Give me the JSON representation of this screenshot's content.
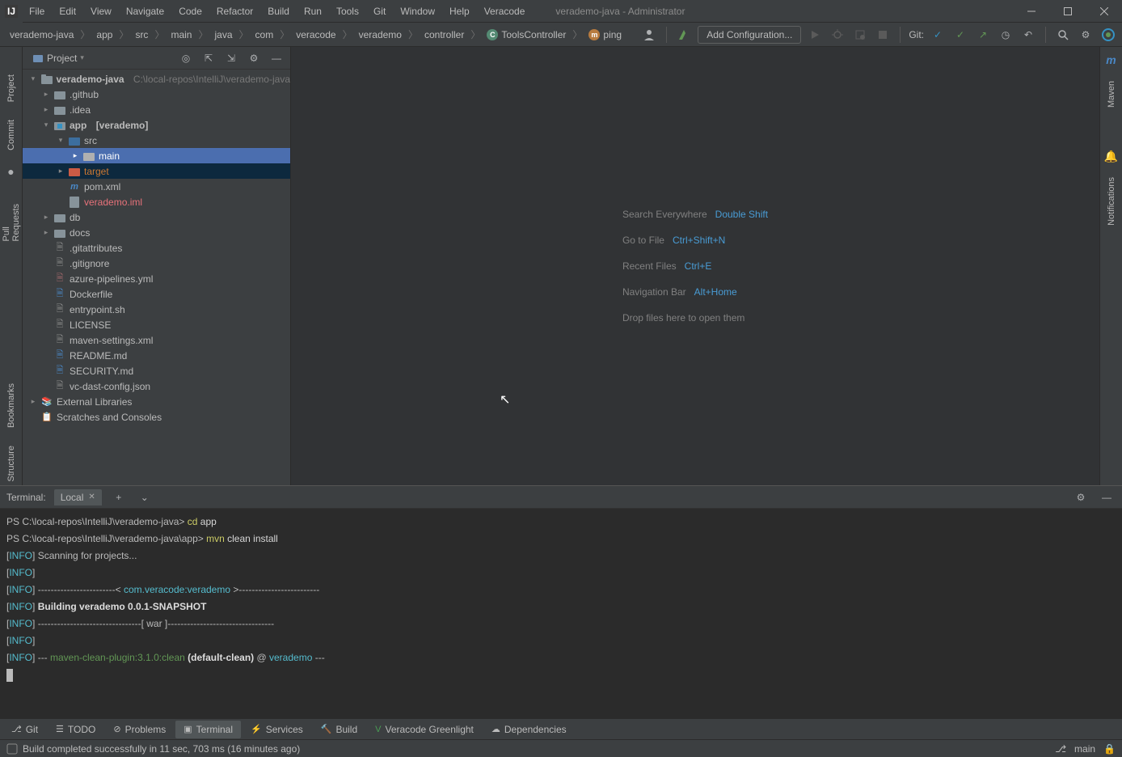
{
  "title": "verademo-java - Administrator",
  "menu": [
    "File",
    "Edit",
    "View",
    "Navigate",
    "Code",
    "Refactor",
    "Build",
    "Run",
    "Tools",
    "Git",
    "Window",
    "Help",
    "Veracode"
  ],
  "breadcrumb": [
    "verademo-java",
    "app",
    "src",
    "main",
    "java",
    "com",
    "veracode",
    "verademo",
    "controller",
    "ToolsController",
    "ping"
  ],
  "toolbar": {
    "add_config": "Add Configuration...",
    "git_label": "Git:"
  },
  "project_panel": {
    "title": "Project"
  },
  "tree": {
    "root": {
      "name": "verademo-java",
      "hint": "C:\\local-repos\\IntelliJ\\verademo-java"
    },
    "github": ".github",
    "idea": ".idea",
    "app": "app",
    "app_hint": "[verademo]",
    "src": "src",
    "main": "main",
    "target": "target",
    "pom": "pom.xml",
    "iml": "verademo.iml",
    "db": "db",
    "docs": "docs",
    "gitattr": ".gitattributes",
    "gitign": ".gitignore",
    "azure": "azure-pipelines.yml",
    "docker": "Dockerfile",
    "entry": "entrypoint.sh",
    "license": "LICENSE",
    "mvnset": "maven-settings.xml",
    "readme": "README.md",
    "security": "SECURITY.md",
    "vcdast": "vc-dast-config.json",
    "extlib": "External Libraries",
    "scratch": "Scratches and Consoles"
  },
  "hints": {
    "search_l": "Search Everywhere",
    "search_s": "Double Shift",
    "goto_l": "Go to File",
    "goto_s": "Ctrl+Shift+N",
    "recent_l": "Recent Files",
    "recent_s": "Ctrl+E",
    "nav_l": "Navigation Bar",
    "nav_s": "Alt+Home",
    "drop": "Drop files here to open them"
  },
  "terminal": {
    "title": "Terminal:",
    "tab": "Local",
    "line1_ps": "PS C:\\local-repos\\IntelliJ\\verademo-java> ",
    "line1_cmd1": "cd ",
    "line1_cmd2": "app",
    "line2_ps": "PS C:\\local-repos\\IntelliJ\\verademo-java\\app> ",
    "line2_cmd1": "mvn ",
    "line2_cmd2": "clean install",
    "info": "INFO",
    "scan": " Scanning for projects...",
    "sep1": " ------------------------< ",
    "pkg": "com.veracode:verademo",
    "sep1b": " >-------------------------",
    "build": " Building verademo 0.0.1-SNAPSHOT",
    "war": " --------------------------------[ war ]---------------------------------",
    "plug1": " --- ",
    "plugin": "maven-clean-plugin:3.1.0:clean",
    "plug2": " (default-clean)",
    "plug_at": " @ ",
    "proj": "verademo",
    "plug3": " ---"
  },
  "bottom_tabs": {
    "git": "Git",
    "todo": "TODO",
    "problems": "Problems",
    "terminal": "Terminal",
    "services": "Services",
    "build": "Build",
    "veracode": "Veracode Greenlight",
    "deps": "Dependencies"
  },
  "status": {
    "msg": "Build completed successfully in 11 sec, 703 ms (16 minutes ago)",
    "branch": "main"
  },
  "right_gutter": {
    "maven": "Maven",
    "notif": "Notifications"
  }
}
